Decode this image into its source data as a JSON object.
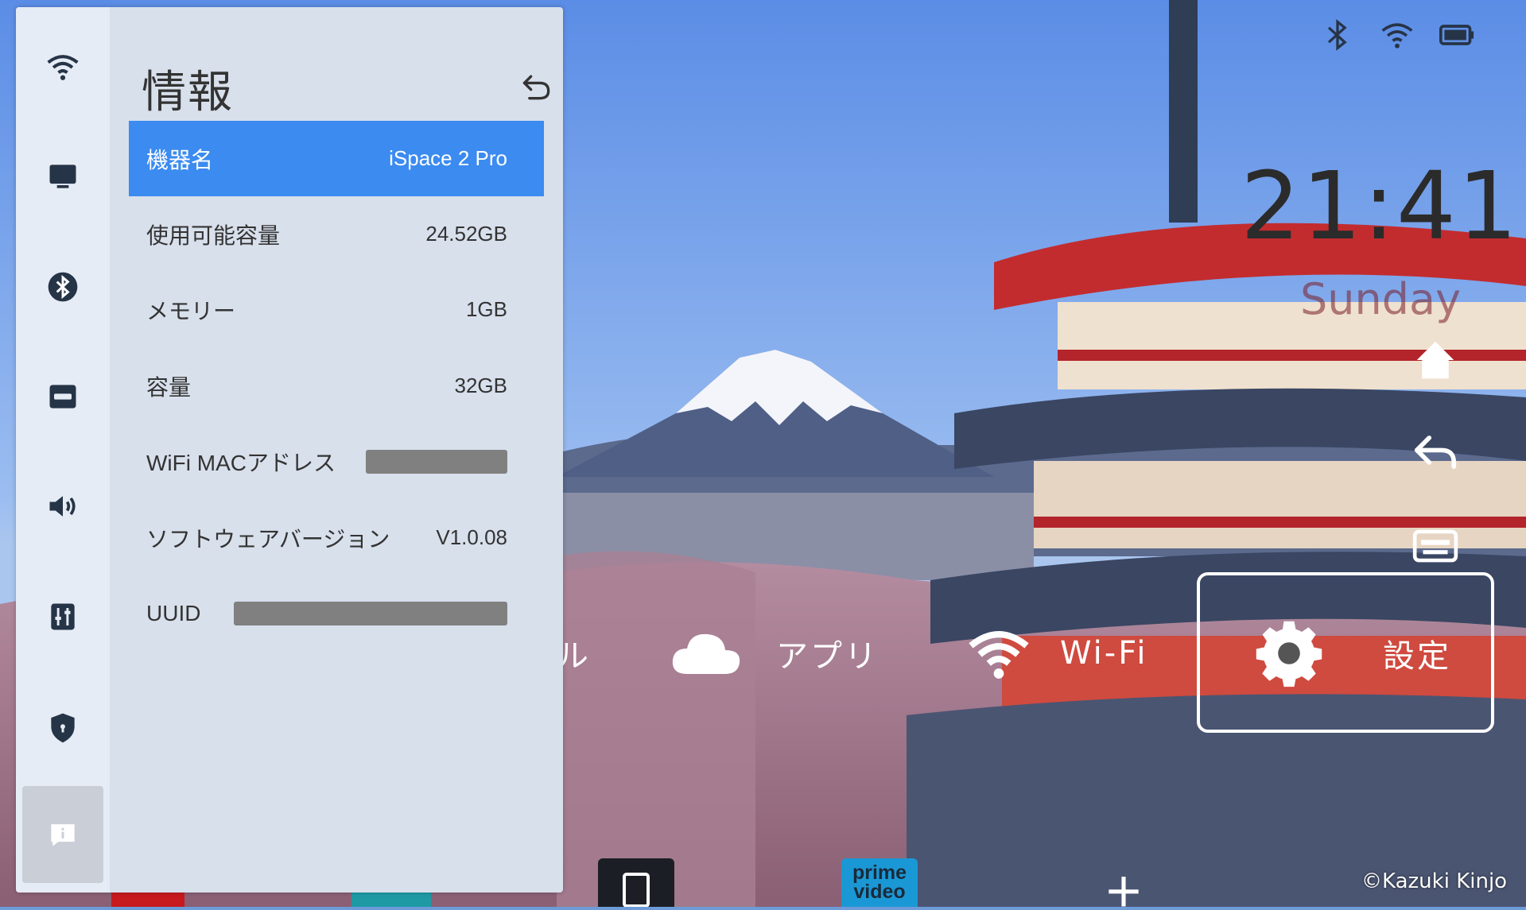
{
  "panel": {
    "title": "情報",
    "rows": [
      {
        "label": "機器名",
        "value": "iSpace 2 Pro"
      },
      {
        "label": "使用可能容量",
        "value": "24.52GB"
      },
      {
        "label": "メモリー",
        "value": "1GB"
      },
      {
        "label": "容量",
        "value": "32GB"
      },
      {
        "label": "WiFi MACアドレス",
        "value": ""
      },
      {
        "label": "ソフトウェアバージョン",
        "value": "V1.0.08"
      },
      {
        "label": "UUID",
        "value": ""
      }
    ],
    "rail_icons": [
      "wifi-icon",
      "display-icon",
      "bluetooth-icon",
      "hdmi-icon",
      "volume-icon",
      "equalizer-icon",
      "shield-icon",
      "info-icon"
    ]
  },
  "home": {
    "clock": "21:41",
    "day": "Sunday",
    "tiles": [
      {
        "label": "アプリ",
        "icon": "cloud-icon"
      },
      {
        "label": "Wi-Fi",
        "icon": "wifi-icon"
      },
      {
        "label": "設定",
        "icon": "gear-icon"
      }
    ],
    "partial_tile_text": "ル",
    "dock": {
      "prime_label": "prime video"
    },
    "credit": "©Kazuki Kinjo"
  },
  "colors": {
    "selected_row": "#3b8bf0",
    "panel_bg": "#d8e0ec",
    "rail_bg": "#e6ecf5"
  }
}
